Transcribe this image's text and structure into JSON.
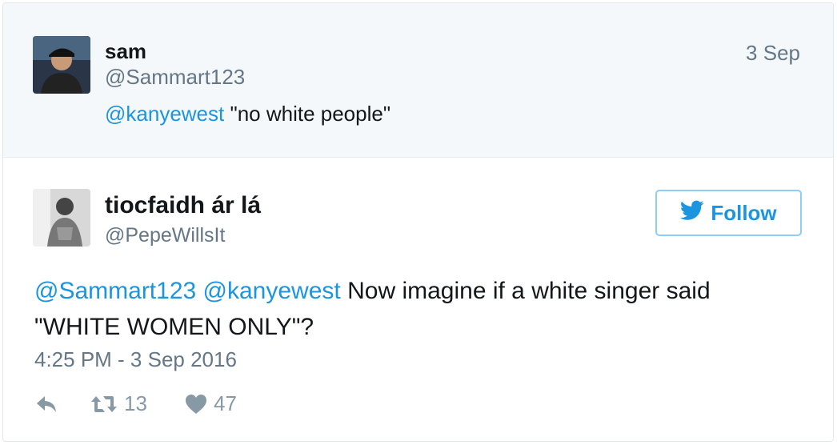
{
  "parent_tweet": {
    "name": "sam",
    "handle": "@Sammart123",
    "date": "3 Sep",
    "mention": "@kanyewest",
    "text": "\"no white people\""
  },
  "main_tweet": {
    "name": "tiocfaidh ár lá",
    "handle": "@PepeWillsIt",
    "follow_label": "Follow",
    "mention_1": "@Sammart123",
    "mention_2": "@kanyewest",
    "text": "Now imagine if a white singer said \"WHITE WOMEN ONLY\"?",
    "timestamp": "4:25 PM - 3 Sep 2016",
    "retweet_count": "13",
    "like_count": "47"
  },
  "colors": {
    "link": "#1b95e0",
    "muted": "#657786",
    "icon": "#8899a6",
    "parent_bg": "#f5f8fa"
  }
}
